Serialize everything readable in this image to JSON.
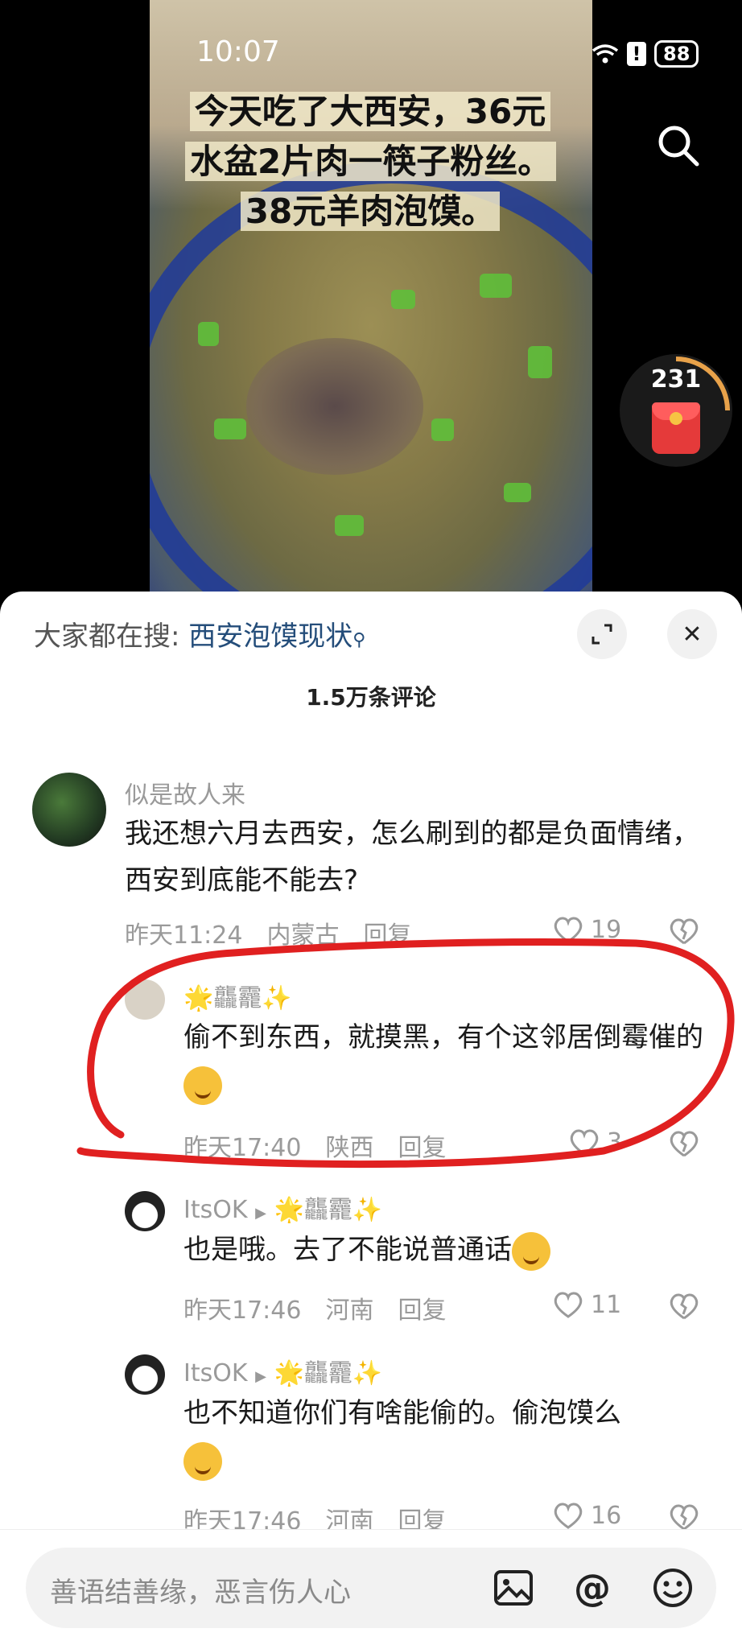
{
  "status_bar": {
    "time": "10:07",
    "battery": "88"
  },
  "video": {
    "caption": "今天吃了大西安，36元水盆2片肉一筷子粉丝。38元羊肉泡馍。",
    "redbag_count": "231"
  },
  "comments_header": {
    "search_prefix": "大家都在搜:",
    "search_term": "西安泡馍现状",
    "title": "1.5万条评论"
  },
  "comments": [
    {
      "name": "似是故人来",
      "text": "我还想六月去西安，怎么刷到的都是负面情绪，西安到底能不能去?",
      "time": "昨天11:24",
      "location": "内蒙古",
      "reply_label": "回复",
      "likes": "19"
    },
    {
      "name": "🌟龘龗✨",
      "text": "偷不到东西，就摸黑，有个这邻居倒霉催的",
      "time": "昨天17:40",
      "location": "陕西",
      "reply_label": "回复",
      "likes": "3"
    },
    {
      "name": "ItsOK",
      "reply_to": "🌟龘龗✨",
      "text": "也是哦。去了不能说普通话",
      "time": "昨天17:46",
      "location": "河南",
      "reply_label": "回复",
      "likes": "11"
    },
    {
      "name": "ItsOK",
      "reply_to": "🌟龘龗✨",
      "text": "也不知道你们有啥能偷的。偷泡馍么",
      "time": "昨天17:46",
      "location": "河南",
      "reply_label": "回复",
      "likes": "16"
    }
  ],
  "input": {
    "placeholder": "善语结善缘，恶言伤人心"
  },
  "colors": {
    "link": "#244d7a",
    "annotation": "#e02020"
  }
}
